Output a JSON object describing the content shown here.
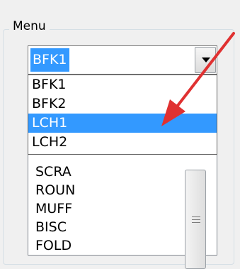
{
  "group": {
    "label": "Menu"
  },
  "combo": {
    "value": "BFK1"
  },
  "dropdown": {
    "items": [
      "BFK1",
      "BFK2",
      "LCH1",
      "LCH2"
    ],
    "selected_index": 2
  },
  "listbox": {
    "items": [
      "SCRA",
      "ROUN",
      "MUFF",
      "BISC",
      "FOLD"
    ]
  },
  "colors": {
    "selection": "#3399ff",
    "arrow": "#e03131"
  }
}
